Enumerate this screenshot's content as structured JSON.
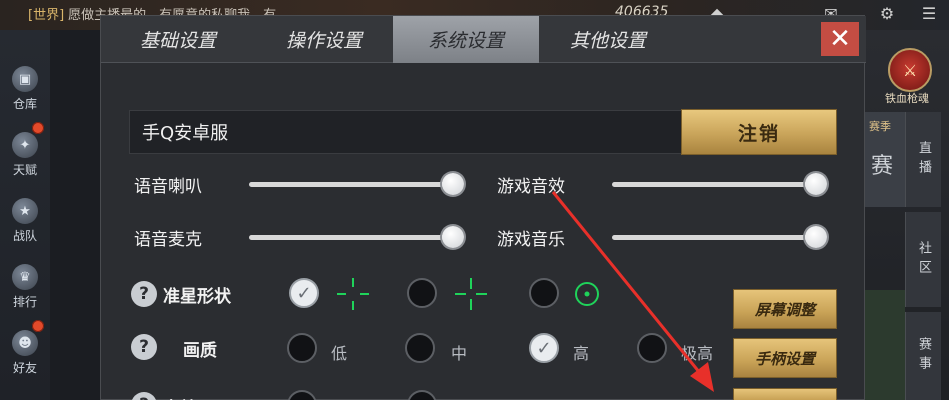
{
  "background": {
    "chat_tag": "[世界]",
    "chat_text": "愿做主播最的，有愿意的私聊我，有",
    "top_number": "406635",
    "left_rail": [
      "仓库",
      "天赋",
      "战队",
      "排行",
      "好友"
    ],
    "right_logo_label": "铁血枪魂",
    "right_tabs": [
      "直播",
      "社区",
      "赛事"
    ],
    "right_strip_text": "赛季",
    "right_strip_text2": "赛"
  },
  "dialog": {
    "tabs": [
      "基础设置",
      "操作设置",
      "系统设置",
      "其他设置"
    ],
    "active_tab": 2,
    "account": "手Q安卓服",
    "logout_label": "注销",
    "sliders": [
      {
        "label": "语音喇叭",
        "level": 1.0
      },
      {
        "label": "游戏音效",
        "level": 1.0
      },
      {
        "label": "语音麦克",
        "level": 1.0
      },
      {
        "label": "游戏音乐",
        "level": 1.0
      }
    ],
    "crosshair_label": "准星形状",
    "quality_label": "画质",
    "quality_options": [
      "低",
      "中",
      "高",
      "极高"
    ],
    "quality_selected": "高",
    "side_buttons": [
      "屏幕调整",
      "手柄设置"
    ],
    "row3_label": "音效"
  },
  "colors": {
    "accent_gold": "#c9a45a",
    "crosshair_green": "#1fd35a",
    "close_red": "#c44d43",
    "arrow_red": "#e8302a"
  }
}
